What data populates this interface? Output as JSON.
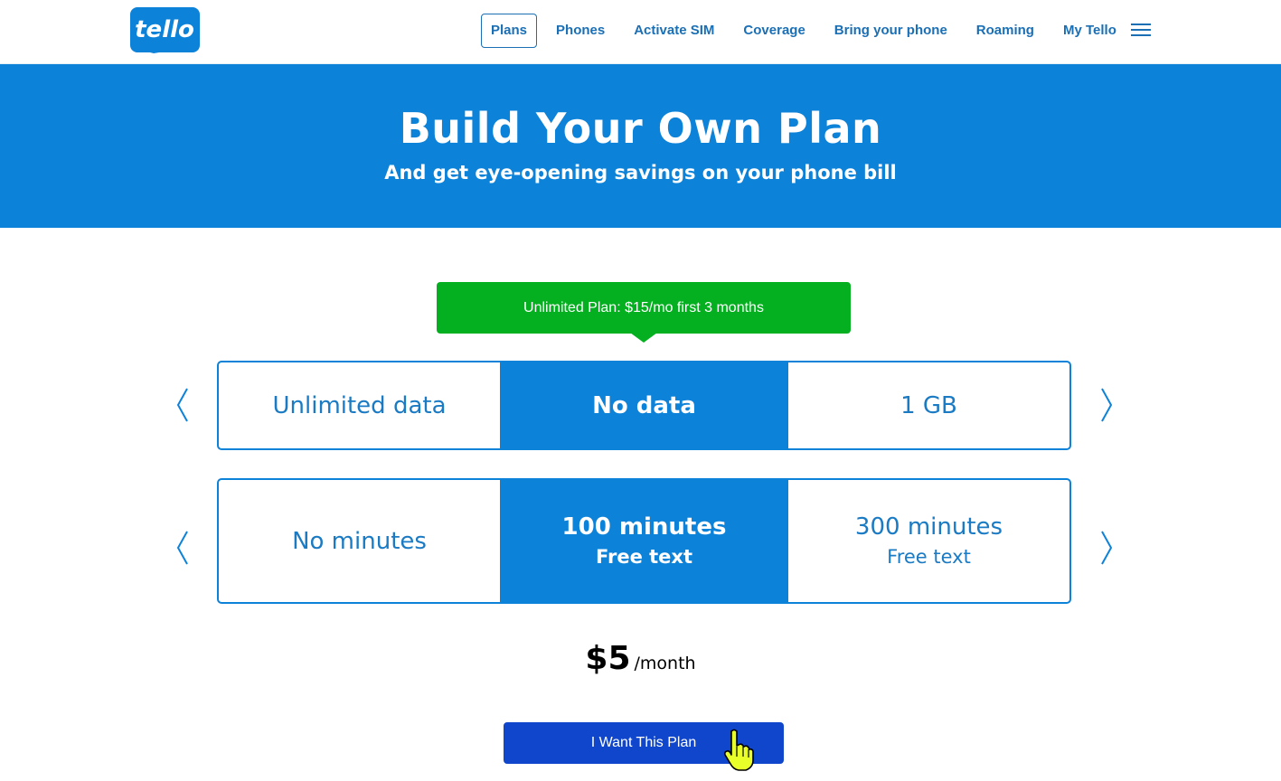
{
  "brand": {
    "logo_text": "tello",
    "color": "#0d82d9"
  },
  "nav": {
    "items": [
      {
        "label": "Plans",
        "active": true
      },
      {
        "label": "Phones"
      },
      {
        "label": "Activate SIM"
      },
      {
        "label": "Coverage"
      },
      {
        "label": "Bring your phone"
      },
      {
        "label": "Roaming"
      },
      {
        "label": "My Tello"
      }
    ],
    "menu_icon": "hamburger-menu-icon"
  },
  "hero": {
    "title": "Build Your Own Plan",
    "subtitle": "And get eye-opening savings on your phone bill",
    "background": "#0d82d9"
  },
  "promo": {
    "label": "Unlimited Plan: $15/mo first 3 months",
    "color": "#04b01f"
  },
  "data_selector": {
    "options": [
      {
        "line1": "Unlimited data",
        "selected": false
      },
      {
        "line1": "No data",
        "selected": true
      },
      {
        "line1": "1 GB",
        "selected": false
      }
    ],
    "prev_icon": "chevron-left-icon",
    "next_icon": "chevron-right-icon"
  },
  "minutes_selector": {
    "options": [
      {
        "line1": "No minutes",
        "line2": "",
        "selected": false
      },
      {
        "line1": "100 minutes",
        "line2": "Free text",
        "selected": true
      },
      {
        "line1": "300 minutes",
        "line2": "Free text",
        "selected": false
      }
    ],
    "prev_icon": "chevron-left-icon",
    "next_icon": "chevron-right-icon"
  },
  "price": {
    "amount": "$5",
    "period": "/month"
  },
  "cta": {
    "label": "I Want This Plan",
    "color": "#1046cc"
  }
}
